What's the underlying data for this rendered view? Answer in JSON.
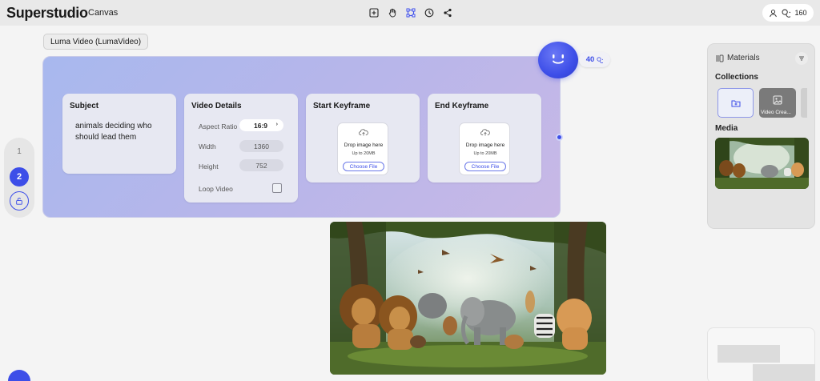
{
  "app": {
    "brand": "Superstudio",
    "breadcrumb": "Canvas"
  },
  "toolbar": {
    "tools": [
      "add-frame-icon",
      "hand-icon",
      "select-frame-icon",
      "history-icon",
      "share-icon"
    ]
  },
  "account": {
    "credits": "160"
  },
  "rail": {
    "page1": "1",
    "page2": "2"
  },
  "node": {
    "label": "Luma Video (LumaVideo)",
    "credits": "40",
    "subject": {
      "title": "Subject",
      "text": "animals deciding who should lead them"
    },
    "video_details": {
      "title": "Video Details",
      "aspect_label": "Aspect Ratio",
      "aspect_value": "16:9",
      "width_label": "Width",
      "width_value": "1360",
      "height_label": "Height",
      "height_value": "752",
      "loop_label": "Loop Video",
      "loop_checked": false
    },
    "start_keyframe": {
      "title": "Start Keyframe",
      "drop_text": "Drop image here",
      "limit": "Up to 20MB",
      "button": "Choose File"
    },
    "end_keyframe": {
      "title": "End Keyframe",
      "drop_text": "Drop image here",
      "limit": "Up to 20MB",
      "button": "Choose File"
    }
  },
  "materials": {
    "title": "Materials",
    "collections_label": "Collections",
    "collection_item": "Video Crea...",
    "media_label": "Media"
  },
  "colors": {
    "accent": "#3d4ee8"
  }
}
